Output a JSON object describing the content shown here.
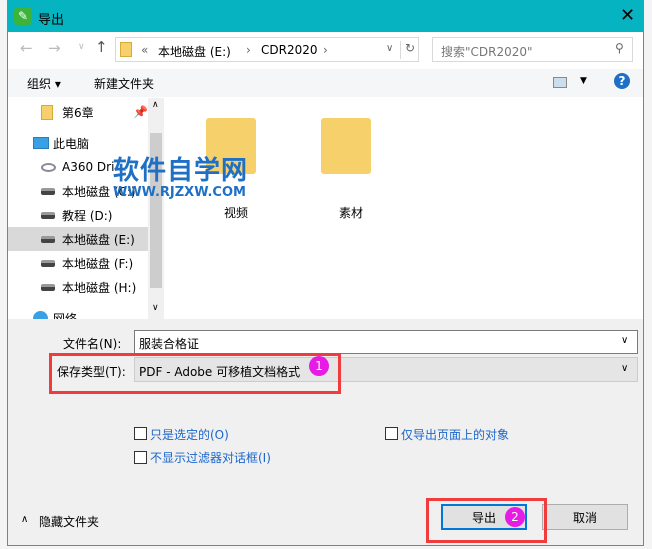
{
  "window": {
    "title": "导出",
    "accent": "#06b4c1"
  },
  "nav": {
    "breadcrumb_prefix": "«",
    "crumbs": [
      "本地磁盘 (E:)",
      "CDR2020"
    ],
    "search_placeholder": "搜索\"CDR2020\""
  },
  "toolbar": {
    "organize": "组织 ▾",
    "new_folder": "新建文件夹",
    "help": "?"
  },
  "sidebar": {
    "items": [
      {
        "label": "第6章",
        "icon": "folder-icon"
      },
      {
        "label": "此电脑",
        "icon": "computer-icon"
      },
      {
        "label": "A360 Dri",
        "icon": "cloud-icon"
      },
      {
        "label": "本地磁盘 (C:)",
        "icon": "drive-icon"
      },
      {
        "label": "教程 (D:)",
        "icon": "drive-icon"
      },
      {
        "label": "本地磁盘 (E:)",
        "icon": "drive-icon",
        "selected": true
      },
      {
        "label": "本地磁盘 (F:)",
        "icon": "drive-icon"
      },
      {
        "label": "本地磁盘 (H:)",
        "icon": "drive-icon"
      },
      {
        "label": "网络",
        "icon": "network-icon"
      }
    ]
  },
  "files": [
    {
      "name": "视频"
    },
    {
      "name": "素材"
    }
  ],
  "watermark": {
    "title": "软件自学网",
    "url": "WWW.RJZXW.COM"
  },
  "form": {
    "filename_label": "文件名(N):",
    "filename_value": "服装合格证",
    "type_label": "保存类型(T):",
    "type_value": "PDF - Adobe 可移植文档格式"
  },
  "options": {
    "selected_only": "只是选定的(O)",
    "page_objects_only": "仅导出页面上的对象",
    "no_filter_dialog": "不显示过滤器对话框(I)"
  },
  "footer": {
    "hide_folders": "隐藏文件夹",
    "export": "导出",
    "cancel": "取消"
  },
  "badges": [
    "1",
    "2"
  ]
}
